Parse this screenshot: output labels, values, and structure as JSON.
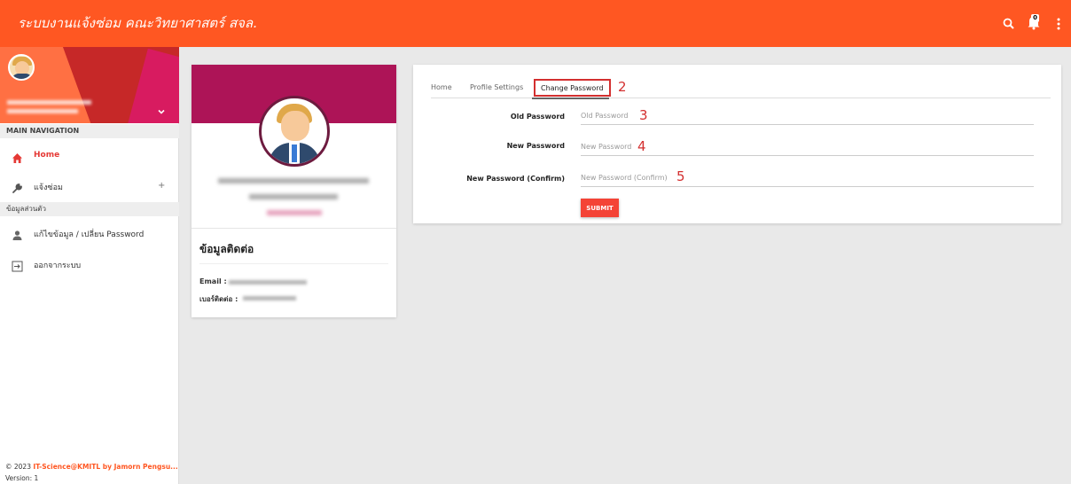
{
  "header": {
    "title": "ระบบงานแจ้งซ่อม คณะวิทยาศาสตร์ สจล.",
    "notification_count": "0",
    "bar_color": "#ff5722"
  },
  "sidebar": {
    "nav_header": "MAIN NAVIGATION",
    "items": [
      {
        "label": "Home",
        "icon": "home-icon"
      },
      {
        "label": "แจ้งซ่อม",
        "icon": "wrench-icon",
        "expand": "+"
      }
    ],
    "section_header": "ข้อมูลส่วนตัว",
    "personal_items": [
      {
        "label": "แก้ไขข้อมูล / เปลี่ยน Password",
        "icon": "person-icon"
      },
      {
        "label": "ออกจากระบบ",
        "icon": "logout-icon"
      }
    ],
    "footer_copyright": "© 2023 ",
    "footer_link": "IT-Science@KMITL by Jamorn Pengsu...",
    "footer_version": "Version: 1"
  },
  "profile_card": {
    "section_title": "ข้อมูลติดต่อ",
    "email_label": "Email :",
    "phone_label": "เบอร์ติดต่อ :",
    "banner_color": "#ad1457"
  },
  "settings": {
    "tabs": [
      {
        "label": "Home"
      },
      {
        "label": "Profile Settings"
      },
      {
        "label": "Change Password",
        "active": true
      }
    ],
    "fields": [
      {
        "label": "Old Password",
        "placeholder": "Old Password",
        "value": ""
      },
      {
        "label": "New Password",
        "placeholder": "New Password",
        "value": ""
      },
      {
        "label": "New Password (Confirm)",
        "placeholder": "New Password (Confirm)",
        "value": ""
      }
    ],
    "submit_label": "SUBMIT",
    "annotations": [
      "2",
      "3",
      "4",
      "5"
    ],
    "accent_color": "#f44336"
  }
}
